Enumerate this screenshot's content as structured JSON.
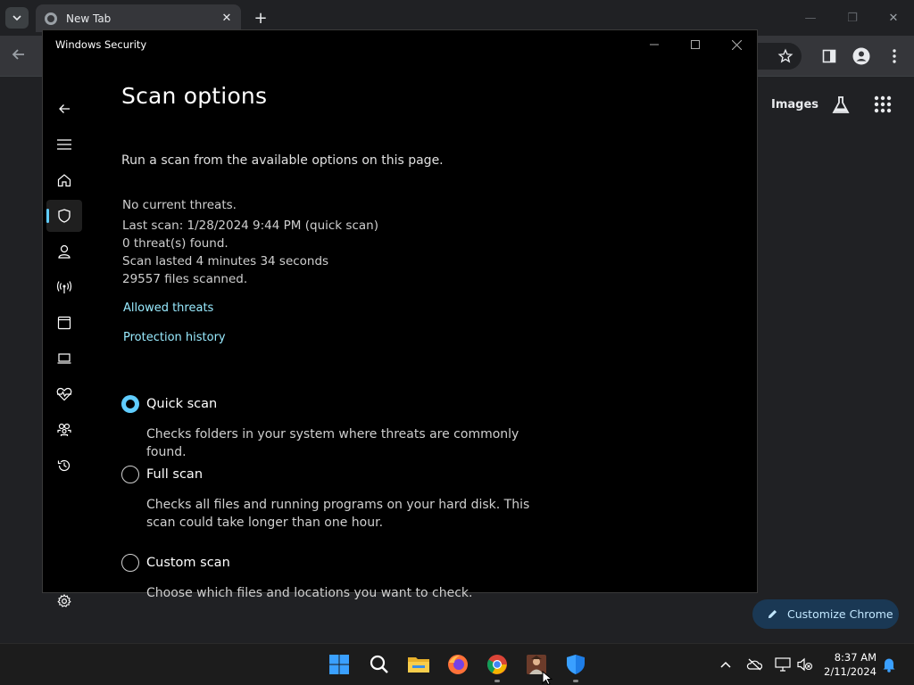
{
  "chrome": {
    "tab_title": "New Tab",
    "images_link": "Images",
    "customize_label": "Customize Chrome"
  },
  "security": {
    "window_title": "Windows Security",
    "page_title": "Scan options",
    "subtitle": "Run a scan from the available options on this page.",
    "status": [
      "No current threats.",
      "Last scan: 1/28/2024 9:44 PM (quick scan)",
      "0 threat(s) found.",
      "Scan lasted 4 minutes 34 seconds",
      "29557 files scanned."
    ],
    "links": [
      "Allowed threats",
      "Protection history"
    ],
    "scan_options": [
      {
        "label": "Quick scan",
        "description": "Checks folders in your system where threats are commonly found.",
        "selected": true
      },
      {
        "label": "Full scan",
        "description": "Checks all files and running programs on your hard disk. This scan could take longer than one hour.",
        "selected": false
      },
      {
        "label": "Custom scan",
        "description": "Choose which files and locations you want to check.",
        "selected": false
      }
    ],
    "nav_icons": [
      "back-icon",
      "menu-icon",
      "home-icon",
      "shield-icon",
      "person-icon",
      "antenna-icon",
      "browser-window-icon",
      "laptop-icon",
      "heart-pulse-icon",
      "family-icon",
      "history-icon",
      "settings-icon"
    ],
    "accent_color": "#60cdff",
    "link_color": "#99ebff"
  },
  "taskbar": {
    "time": "8:37 AM",
    "date": "2/11/2024",
    "apps": [
      "windows-start-icon",
      "search-icon",
      "file-explorer-icon",
      "firefox-icon",
      "chrome-icon",
      "user-app-icon",
      "windows-security-icon"
    ]
  }
}
